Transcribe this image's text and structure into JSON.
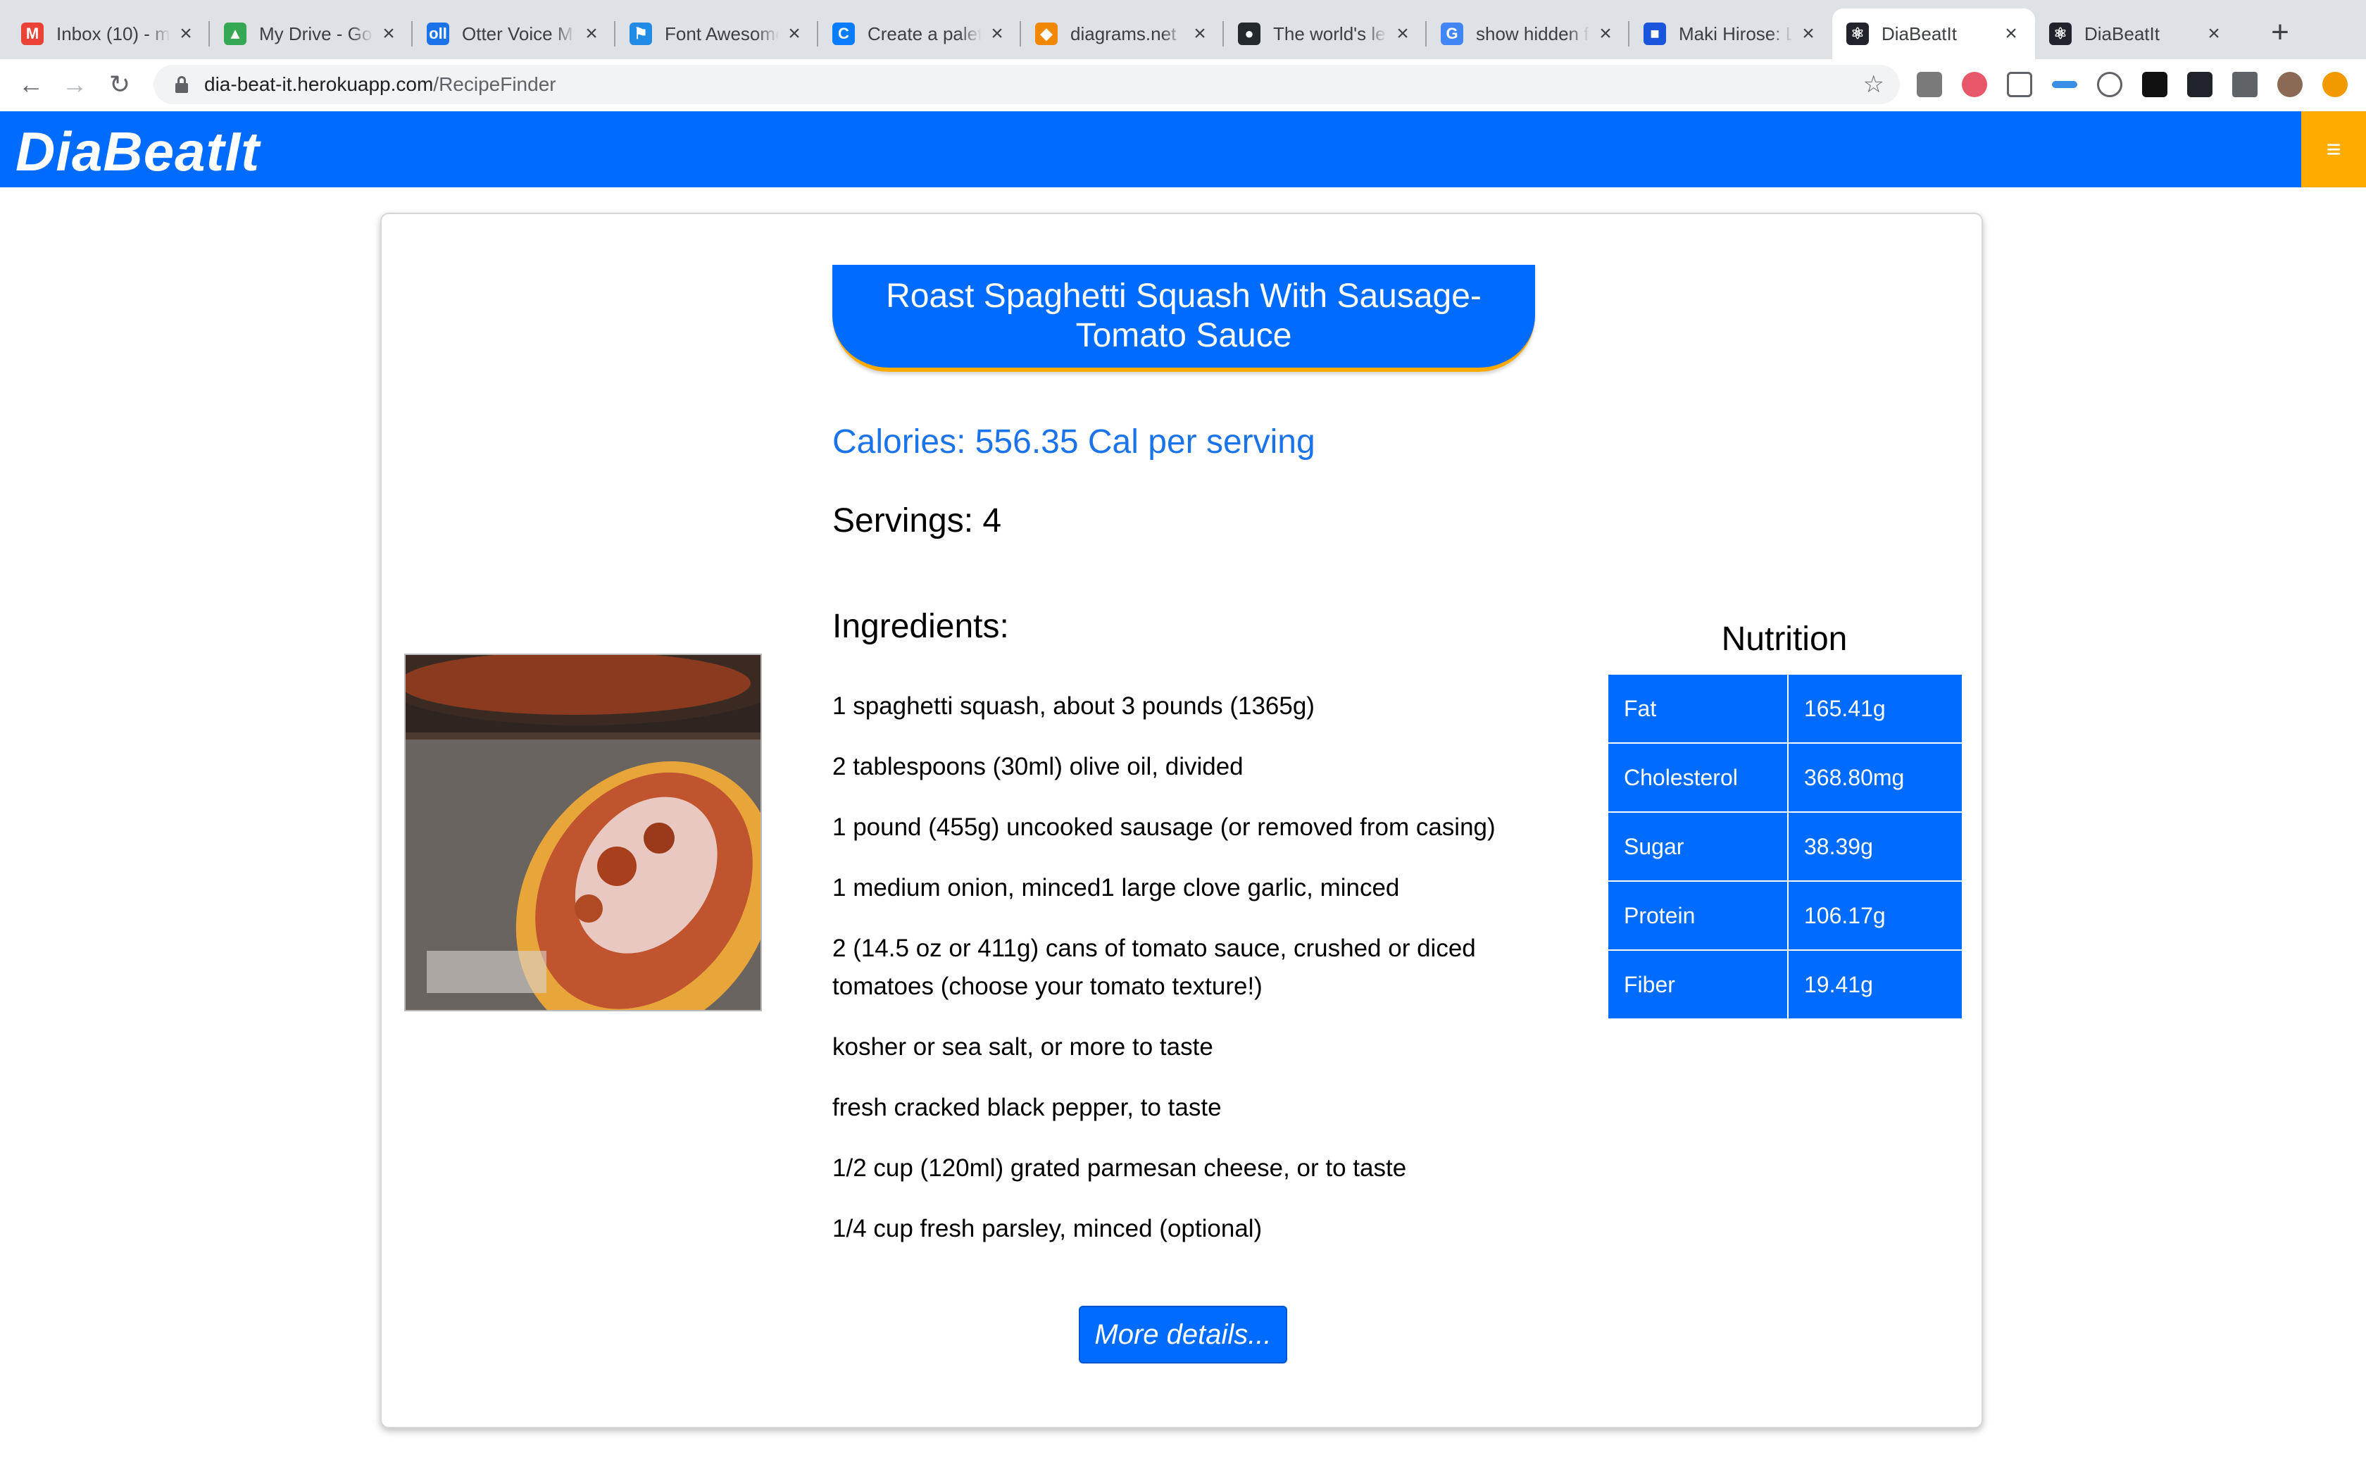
{
  "browser": {
    "tabs": [
      {
        "title": "Inbox (10) - m",
        "icon": "gmail-icon",
        "fav": "M",
        "color": "#ea4335"
      },
      {
        "title": "My Drive - Go",
        "icon": "google-drive-icon",
        "fav": "▲",
        "color": "#34a853"
      },
      {
        "title": "Otter Voice M",
        "icon": "otter-icon",
        "fav": "oll",
        "color": "#1a73e8"
      },
      {
        "title": "Font Awesome",
        "icon": "font-awesome-flag-icon",
        "fav": "⚑",
        "color": "#228be6"
      },
      {
        "title": "Create a palet",
        "icon": "coolors-icon",
        "fav": "C",
        "color": "#0a7cff"
      },
      {
        "title": "diagrams.net",
        "icon": "diagrams-net-icon",
        "fav": "◆",
        "color": "#f08705"
      },
      {
        "title": "The world's le",
        "icon": "github-icon",
        "fav": "●",
        "color": "#24292e"
      },
      {
        "title": "show hidden f",
        "icon": "google-icon",
        "fav": "G",
        "color": "#4285f4"
      },
      {
        "title": "Maki Hirose: L",
        "icon": "app-square-icon",
        "fav": "■",
        "color": "#1a56db"
      },
      {
        "title": "DiaBeatIt",
        "icon": "react-icon",
        "fav": "⚛",
        "color": "#20232a",
        "active": true
      },
      {
        "title": "DiaBeatIt",
        "icon": "react-icon",
        "fav": "⚛",
        "color": "#20232a"
      }
    ],
    "url_host": "dia-beat-it.herokuapp.com",
    "url_path": "/RecipeFinder"
  },
  "app": {
    "brand": "DiaBeatIt",
    "menu_icon": "≡"
  },
  "recipe": {
    "title": "Roast Spaghetti Squash With Sausage-Tomato Sauce",
    "calories": "Calories: 556.35 Cal per serving",
    "servings": "Servings: 4",
    "ingredients_heading": "Ingredients:",
    "ingredients": [
      "1 spaghetti squash, about 3 pounds (1365g)",
      "2 tablespoons (30ml) olive oil, divided",
      "1 pound (455g) uncooked sausage (or removed from casing)",
      "1 medium onion, minced1 large clove garlic, minced",
      "2 (14.5 oz or 411g) cans of tomato sauce, crushed or diced tomatoes (choose your tomato texture!)",
      "kosher or sea salt, or more to taste",
      "fresh cracked black pepper, to taste",
      "1/2 cup (120ml) grated parmesan cheese, or to taste",
      "1/4 cup fresh parsley, minced (optional)"
    ],
    "more_button": "More details..."
  },
  "nutrition": {
    "title": "Nutrition",
    "rows": [
      {
        "label": "Fat",
        "value": "165.41g"
      },
      {
        "label": "Cholesterol",
        "value": "368.80mg"
      },
      {
        "label": "Sugar",
        "value": "38.39g"
      },
      {
        "label": "Protein",
        "value": "106.17g"
      },
      {
        "label": "Fiber",
        "value": "19.41g"
      }
    ]
  },
  "colors": {
    "primary": "#006cff",
    "accent": "#ffab00"
  }
}
